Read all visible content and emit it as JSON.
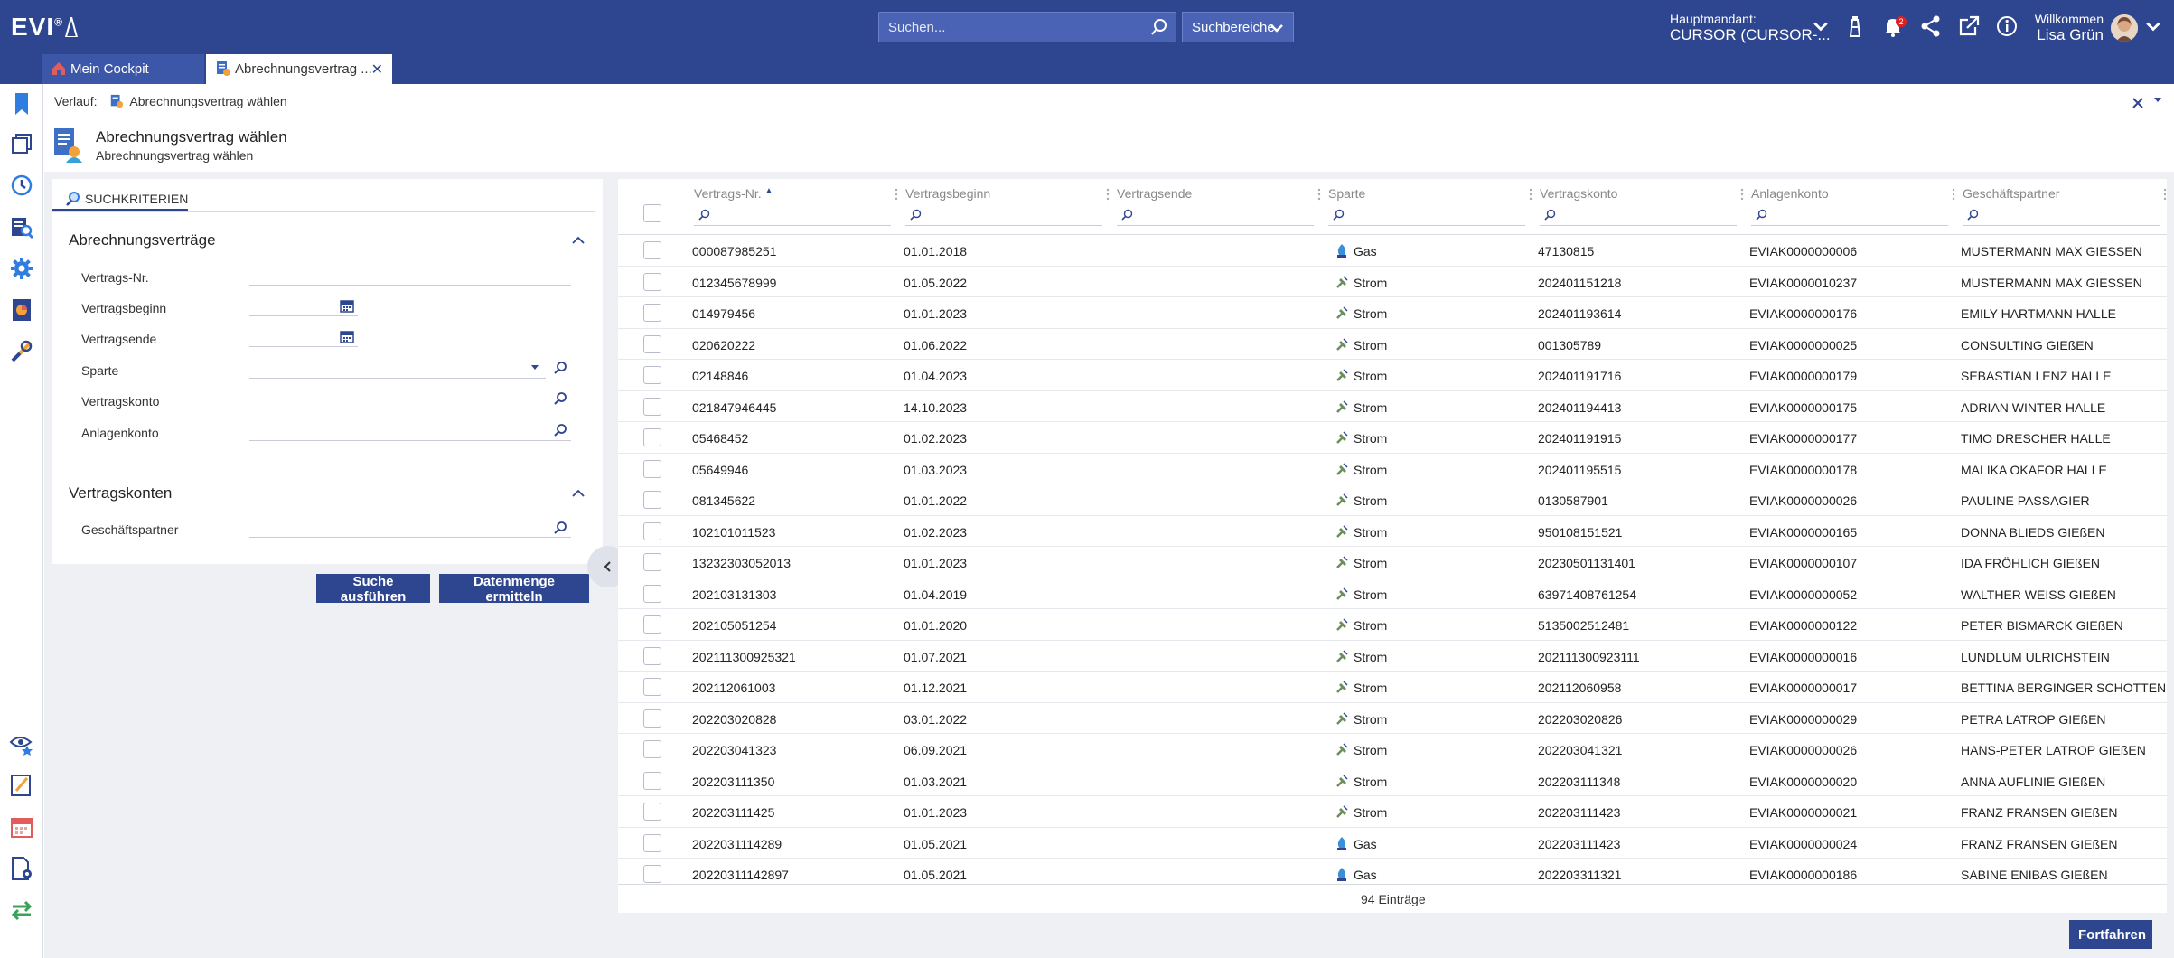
{
  "app": {
    "logo": "EVI",
    "logo_mark": "®"
  },
  "topbar": {
    "search_placeholder": "Suchen...",
    "search_area_label": "Suchbereiche",
    "mandant_label": "Hauptmandant:",
    "mandant_value": "CURSOR (CURSOR-...",
    "notification_count": "2",
    "welcome_label": "Willkommen",
    "user_name": "Lisa Grün"
  },
  "tabs": [
    {
      "label": "Mein Cockpit"
    },
    {
      "label": "Abrechnungsvertrag ...",
      "close": "✕"
    }
  ],
  "breadcrumb": {
    "prefix": "Verlauf:",
    "item": "Abrechnungsvertrag wählen"
  },
  "page": {
    "title": "Abrechnungsvertrag wählen",
    "subtitle": "Abrechnungsvertrag wählen"
  },
  "search_panel": {
    "tab_label": "SUCHKRITERIEN",
    "group1_title": "Abrechnungsverträge",
    "group1_fields": [
      "Vertrags-Nr.",
      "Vertragsbeginn",
      "Vertragsende",
      "Sparte",
      "Vertragskonto",
      "Anlagenkonto"
    ],
    "group2_title": "Vertragskonten",
    "group2_fields": [
      "Geschäftspartner"
    ],
    "btn_search": "Suche ausführen",
    "btn_count": "Datenmenge ermitteln"
  },
  "grid": {
    "columns": [
      "Vertrags-Nr.",
      "Vertragsbeginn",
      "Vertragsende",
      "Sparte",
      "Vertragskonto",
      "Anlagenkonto",
      "Geschäftspartner"
    ],
    "sort_indicator": "▲",
    "rows": [
      [
        "000087985251",
        "01.01.2018",
        "",
        "Gas",
        "47130815",
        "EVIAK0000000006",
        "MUSTERMANN MAX GIESSEN"
      ],
      [
        "012345678999",
        "01.05.2022",
        "",
        "Strom",
        "202401151218",
        "EVIAK0000010237",
        "MUSTERMANN MAX GIESSEN"
      ],
      [
        "014979456",
        "01.01.2023",
        "",
        "Strom",
        "202401193614",
        "EVIAK0000000176",
        "EMILY HARTMANN HALLE"
      ],
      [
        "020620222",
        "01.06.2022",
        "",
        "Strom",
        "001305789",
        "EVIAK0000000025",
        "CONSULTING GIEßEN"
      ],
      [
        "02148846",
        "01.04.2023",
        "",
        "Strom",
        "202401191716",
        "EVIAK0000000179",
        "SEBASTIAN LENZ HALLE"
      ],
      [
        "021847946445",
        "14.10.2023",
        "",
        "Strom",
        "202401194413",
        "EVIAK0000000175",
        "ADRIAN WINTER HALLE"
      ],
      [
        "05468452",
        "01.02.2023",
        "",
        "Strom",
        "202401191915",
        "EVIAK0000000177",
        "TIMO DRESCHER HALLE"
      ],
      [
        "05649946",
        "01.03.2023",
        "",
        "Strom",
        "202401195515",
        "EVIAK0000000178",
        "MALIKA OKAFOR HALLE"
      ],
      [
        "081345622",
        "01.01.2022",
        "",
        "Strom",
        "0130587901",
        "EVIAK0000000026",
        "PAULINE PASSAGIER"
      ],
      [
        "102101011523",
        "01.02.2023",
        "",
        "Strom",
        "950108151521",
        "EVIAK0000000165",
        "DONNA BLIEDS GIEßEN"
      ],
      [
        "13232303052013",
        "01.01.2023",
        "",
        "Strom",
        "20230501131401",
        "EVIAK0000000107",
        "IDA FRÖHLICH GIEßEN"
      ],
      [
        "202103131303",
        "01.04.2019",
        "",
        "Strom",
        "63971408761254",
        "EVIAK0000000052",
        "WALTHER WEISS GIEßEN"
      ],
      [
        "202105051254",
        "01.01.2020",
        "",
        "Strom",
        "5135002512481",
        "EVIAK0000000122",
        "PETER BISMARCK GIEßEN"
      ],
      [
        "202111300925321",
        "01.07.2021",
        "",
        "Strom",
        "202111300923111",
        "EVIAK0000000016",
        "LUNDLUM ULRICHSTEIN"
      ],
      [
        "202112061003",
        "01.12.2021",
        "",
        "Strom",
        "202112060958",
        "EVIAK0000000017",
        "BETTINA BERGINGER SCHOTTEN"
      ],
      [
        "202203020828",
        "03.01.2022",
        "",
        "Strom",
        "202203020826",
        "EVIAK0000000029",
        "PETRA LATROP GIEßEN"
      ],
      [
        "202203041323",
        "06.09.2021",
        "",
        "Strom",
        "202203041321",
        "EVIAK0000000026",
        "HANS-PETER LATROP GIEßEN"
      ],
      [
        "202203111350",
        "01.03.2021",
        "",
        "Strom",
        "202203111348",
        "EVIAK0000000020",
        "ANNA AUFLINIE GIEßEN"
      ],
      [
        "202203111425",
        "01.01.2023",
        "",
        "Strom",
        "202203111423",
        "EVIAK0000000021",
        "FRANZ FRANSEN GIEßEN"
      ],
      [
        "2022031114289",
        "01.05.2021",
        "",
        "Gas",
        "202203111423",
        "EVIAK0000000024",
        "FRANZ FRANSEN GIEßEN"
      ],
      [
        "20220311142897",
        "01.05.2021",
        "",
        "Gas",
        "202203311321",
        "EVIAK0000000186",
        "SABINE ENIBAS GIEßEN"
      ]
    ],
    "count": "94 Einträge"
  },
  "footer": {
    "btn_next": "Fortfahren"
  },
  "colors": {
    "brand": "#2e4590",
    "work_bg": "#eef0f4",
    "strom": "#6b8e5a",
    "gas": "#3a8fd6"
  }
}
